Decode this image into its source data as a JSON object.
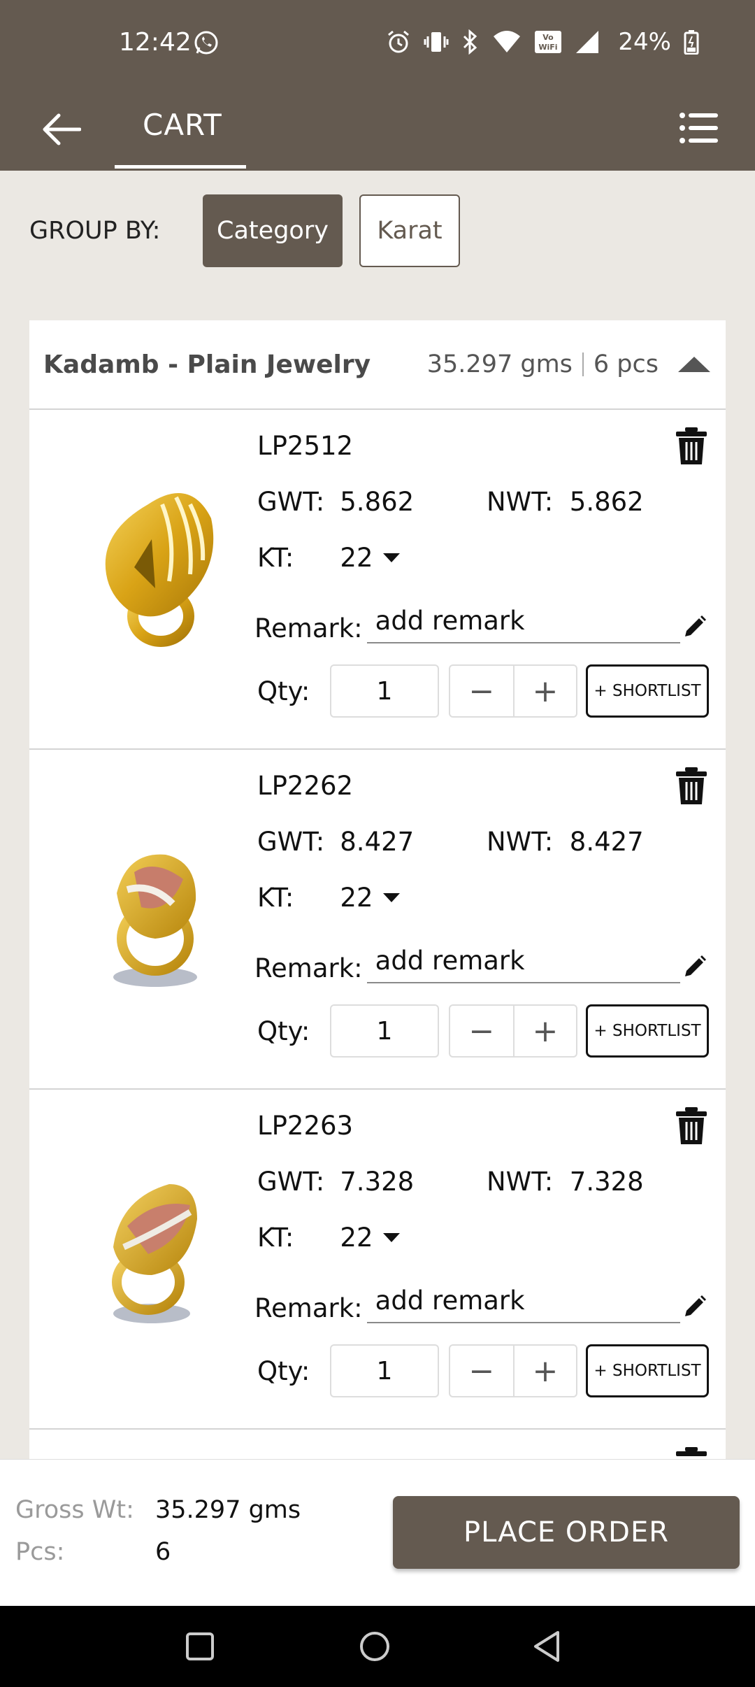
{
  "status_bar": {
    "time": "12:42",
    "battery_pct": "24%",
    "icons": [
      "whatsapp-icon",
      "alarm-icon",
      "vibrate-icon",
      "bluetooth-icon",
      "wifi-icon",
      "vowifi-icon",
      "signal-icon",
      "battery-icon"
    ]
  },
  "appbar": {
    "title": "CART",
    "icons": [
      "back-arrow-icon",
      "menu-list-icon"
    ]
  },
  "groupby": {
    "label": "GROUP BY:",
    "options": [
      "Category",
      "Karat"
    ],
    "selected": "Category"
  },
  "group": {
    "title": "Kadamb - Plain Jewelry",
    "weight": "35.297 gms",
    "pieces": "6 pcs"
  },
  "labels": {
    "gwt": "GWT:",
    "nwt": "NWT:",
    "kt": "KT:",
    "remark": "Remark:",
    "qty": "Qty:",
    "shortlist": "+ SHORTLIST",
    "minus": "−",
    "plus": "+"
  },
  "items": [
    {
      "code": "LP2512",
      "gwt": "5.862",
      "nwt": "5.862",
      "kt": "22",
      "remark": "add remark",
      "qty": "1"
    },
    {
      "code": "LP2262",
      "gwt": "8.427",
      "nwt": "8.427",
      "kt": "22",
      "remark": "add remark",
      "qty": "1"
    },
    {
      "code": "LP2263",
      "gwt": "7.328",
      "nwt": "7.328",
      "kt": "22",
      "remark": "add remark",
      "qty": "1"
    }
  ],
  "summary": {
    "gross_label": "Gross Wt:",
    "gross_value": "35.297 gms",
    "pcs_label": "Pcs:",
    "pcs_value": "6",
    "place_order": "PLACE ORDER"
  },
  "colors": {
    "brand": "#645a50",
    "background": "#ebe8e3"
  }
}
